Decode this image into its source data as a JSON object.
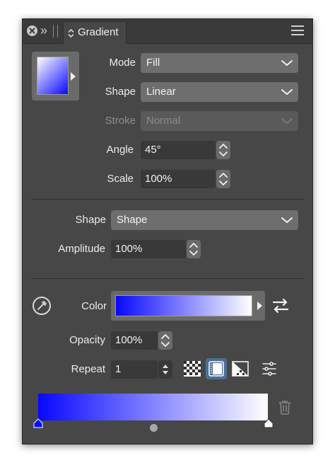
{
  "panel": {
    "tab_title": "Gradient",
    "icons": {
      "close": "close-icon",
      "collapse": "double-chevron-right-icon",
      "menu": "hamburger-menu-icon"
    }
  },
  "mode": {
    "label": "Mode",
    "value": "Fill"
  },
  "shape": {
    "label": "Shape",
    "value": "Linear"
  },
  "stroke": {
    "label": "Stroke",
    "value": "Normal",
    "disabled": true
  },
  "angle": {
    "label": "Angle",
    "value": "45°"
  },
  "scale": {
    "label": "Scale",
    "value": "100%"
  },
  "noise_shape": {
    "label": "Shape",
    "value": "Shape"
  },
  "amplitude": {
    "label": "Amplitude",
    "value": "100%"
  },
  "color": {
    "label": "Color",
    "gradient_start": "#0808ff",
    "gradient_end": "#ffffff"
  },
  "opacity": {
    "label": "Opacity",
    "value": "100%"
  },
  "repeat": {
    "label": "Repeat",
    "value": "1",
    "modes": [
      {
        "name": "transparent-pattern-icon",
        "active": false
      },
      {
        "name": "pad-repeat-icon",
        "active": true
      },
      {
        "name": "reflect-repeat-icon",
        "active": false
      }
    ]
  },
  "colors": {
    "panel_bg": "#474747",
    "dropdown_bg": "#6e6e6e",
    "field_bg": "#393939",
    "accent": "#4e6f94",
    "gradient_start": "#0808ff",
    "gradient_end": "#ffffff"
  }
}
